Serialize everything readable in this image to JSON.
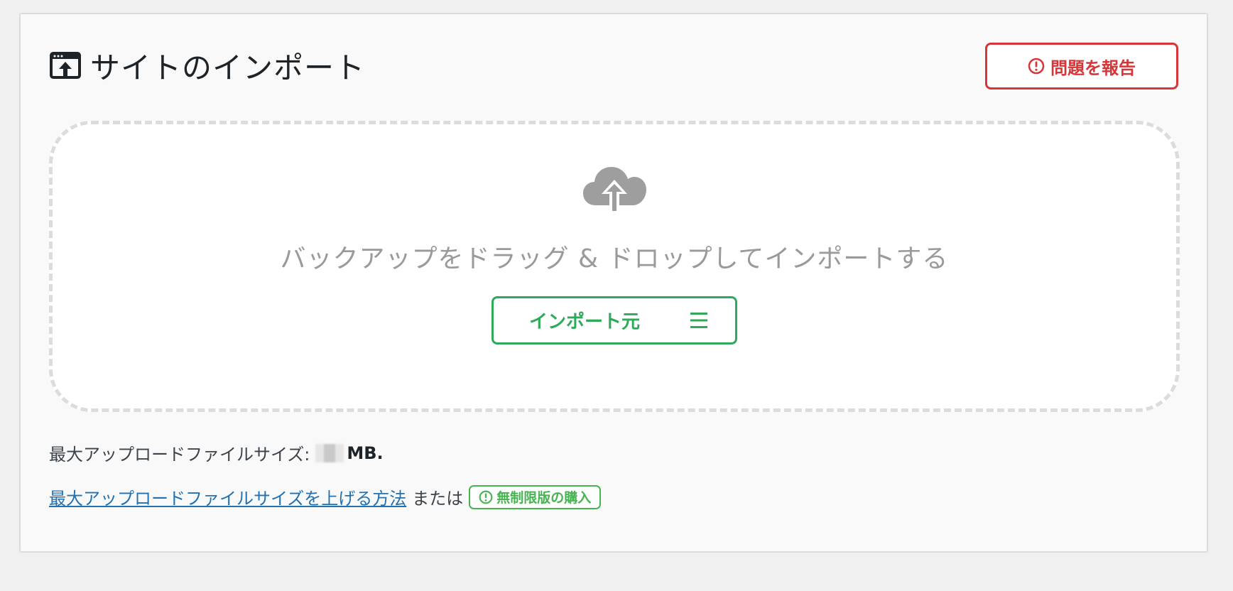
{
  "header": {
    "title": "サイトのインポート",
    "icon": "site-import-icon"
  },
  "report_button": {
    "label": "問題を報告",
    "icon": "alert-circle-icon",
    "color": "#d63638"
  },
  "dropzone": {
    "icon": "cloud-upload-icon",
    "text": "バックアップをドラッグ & ドロップしてインポートする",
    "import_button": {
      "label": "インポート元",
      "icon": "menu-icon",
      "color": "#2faa5a"
    }
  },
  "upload_info": {
    "label": "最大アップロードファイルサイズ:",
    "unit": "MB."
  },
  "help": {
    "link_text": "最大アップロードファイルサイズを上げる方法",
    "or_text": "または",
    "buy_label": "無制限版の購入",
    "buy_icon": "alert-circle-icon",
    "link_color": "#2271b1",
    "buy_color": "#46b450"
  }
}
